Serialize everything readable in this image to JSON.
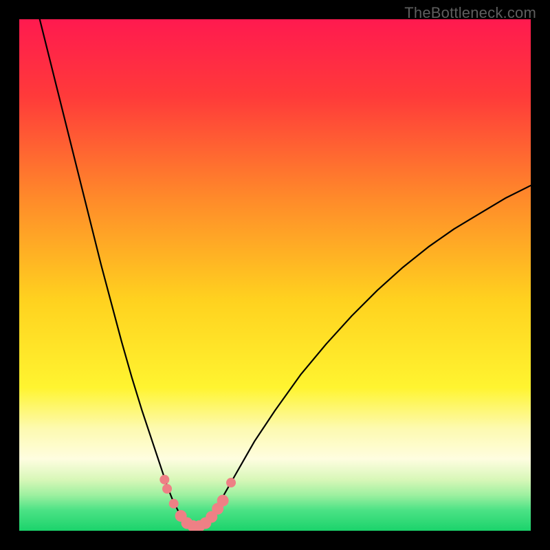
{
  "watermark": "TheBottleneck.com",
  "chart_data": {
    "type": "line",
    "title": "",
    "xlabel": "",
    "ylabel": "",
    "xlim": [
      0,
      100
    ],
    "ylim": [
      0,
      100
    ],
    "grid": false,
    "legend": false,
    "gradient_stops": [
      {
        "pos": 0.0,
        "color": "#ff1a4f"
      },
      {
        "pos": 0.15,
        "color": "#ff3a3a"
      },
      {
        "pos": 0.35,
        "color": "#ff8a2a"
      },
      {
        "pos": 0.55,
        "color": "#ffd21f"
      },
      {
        "pos": 0.72,
        "color": "#fff430"
      },
      {
        "pos": 0.8,
        "color": "#fdfab0"
      },
      {
        "pos": 0.86,
        "color": "#fefde0"
      },
      {
        "pos": 0.9,
        "color": "#d8f7b8"
      },
      {
        "pos": 0.93,
        "color": "#9ef0a0"
      },
      {
        "pos": 0.96,
        "color": "#4be285"
      },
      {
        "pos": 1.0,
        "color": "#1bd36b"
      }
    ],
    "series": [
      {
        "name": "curve",
        "stroke": "#000000",
        "stroke_width": 2.2,
        "points": [
          {
            "x": 4.0,
            "y": 100.0
          },
          {
            "x": 6.0,
            "y": 92.0
          },
          {
            "x": 8.0,
            "y": 84.0
          },
          {
            "x": 10.0,
            "y": 76.0
          },
          {
            "x": 12.0,
            "y": 68.0
          },
          {
            "x": 14.0,
            "y": 60.0
          },
          {
            "x": 16.0,
            "y": 52.0
          },
          {
            "x": 18.0,
            "y": 44.5
          },
          {
            "x": 20.0,
            "y": 37.0
          },
          {
            "x": 22.0,
            "y": 30.0
          },
          {
            "x": 24.0,
            "y": 23.5
          },
          {
            "x": 25.0,
            "y": 20.5
          },
          {
            "x": 26.0,
            "y": 17.5
          },
          {
            "x": 27.0,
            "y": 14.5
          },
          {
            "x": 28.0,
            "y": 11.5
          },
          {
            "x": 29.0,
            "y": 8.5
          },
          {
            "x": 30.0,
            "y": 6.0
          },
          {
            "x": 31.0,
            "y": 4.0
          },
          {
            "x": 32.0,
            "y": 2.3
          },
          {
            "x": 33.0,
            "y": 1.3
          },
          {
            "x": 34.0,
            "y": 0.8
          },
          {
            "x": 35.0,
            "y": 0.8
          },
          {
            "x": 36.0,
            "y": 1.3
          },
          {
            "x": 37.0,
            "y": 2.3
          },
          {
            "x": 38.0,
            "y": 3.8
          },
          {
            "x": 40.0,
            "y": 7.0
          },
          {
            "x": 42.0,
            "y": 10.5
          },
          {
            "x": 44.0,
            "y": 14.0
          },
          {
            "x": 46.0,
            "y": 17.5
          },
          {
            "x": 48.0,
            "y": 20.5
          },
          {
            "x": 50.0,
            "y": 23.5
          },
          {
            "x": 55.0,
            "y": 30.5
          },
          {
            "x": 60.0,
            "y": 36.5
          },
          {
            "x": 65.0,
            "y": 42.0
          },
          {
            "x": 70.0,
            "y": 47.0
          },
          {
            "x": 75.0,
            "y": 51.5
          },
          {
            "x": 80.0,
            "y": 55.5
          },
          {
            "x": 85.0,
            "y": 59.0
          },
          {
            "x": 90.0,
            "y": 62.0
          },
          {
            "x": 95.0,
            "y": 65.0
          },
          {
            "x": 100.0,
            "y": 67.5
          }
        ]
      }
    ],
    "markers": {
      "fill": "#ee8085",
      "radius_large": 8.5,
      "radius_small": 7.0,
      "points": [
        {
          "x": 28.4,
          "y": 10.0,
          "r": "small"
        },
        {
          "x": 28.9,
          "y": 8.2,
          "r": "small"
        },
        {
          "x": 30.2,
          "y": 5.3,
          "r": "small"
        },
        {
          "x": 31.6,
          "y": 2.9,
          "r": "large"
        },
        {
          "x": 32.8,
          "y": 1.5,
          "r": "large"
        },
        {
          "x": 34.0,
          "y": 0.9,
          "r": "large"
        },
        {
          "x": 35.2,
          "y": 0.9,
          "r": "large"
        },
        {
          "x": 36.4,
          "y": 1.5,
          "r": "large"
        },
        {
          "x": 37.6,
          "y": 2.7,
          "r": "large"
        },
        {
          "x": 38.8,
          "y": 4.3,
          "r": "large"
        },
        {
          "x": 39.8,
          "y": 5.9,
          "r": "large"
        },
        {
          "x": 41.4,
          "y": 9.4,
          "r": "small"
        }
      ]
    }
  }
}
